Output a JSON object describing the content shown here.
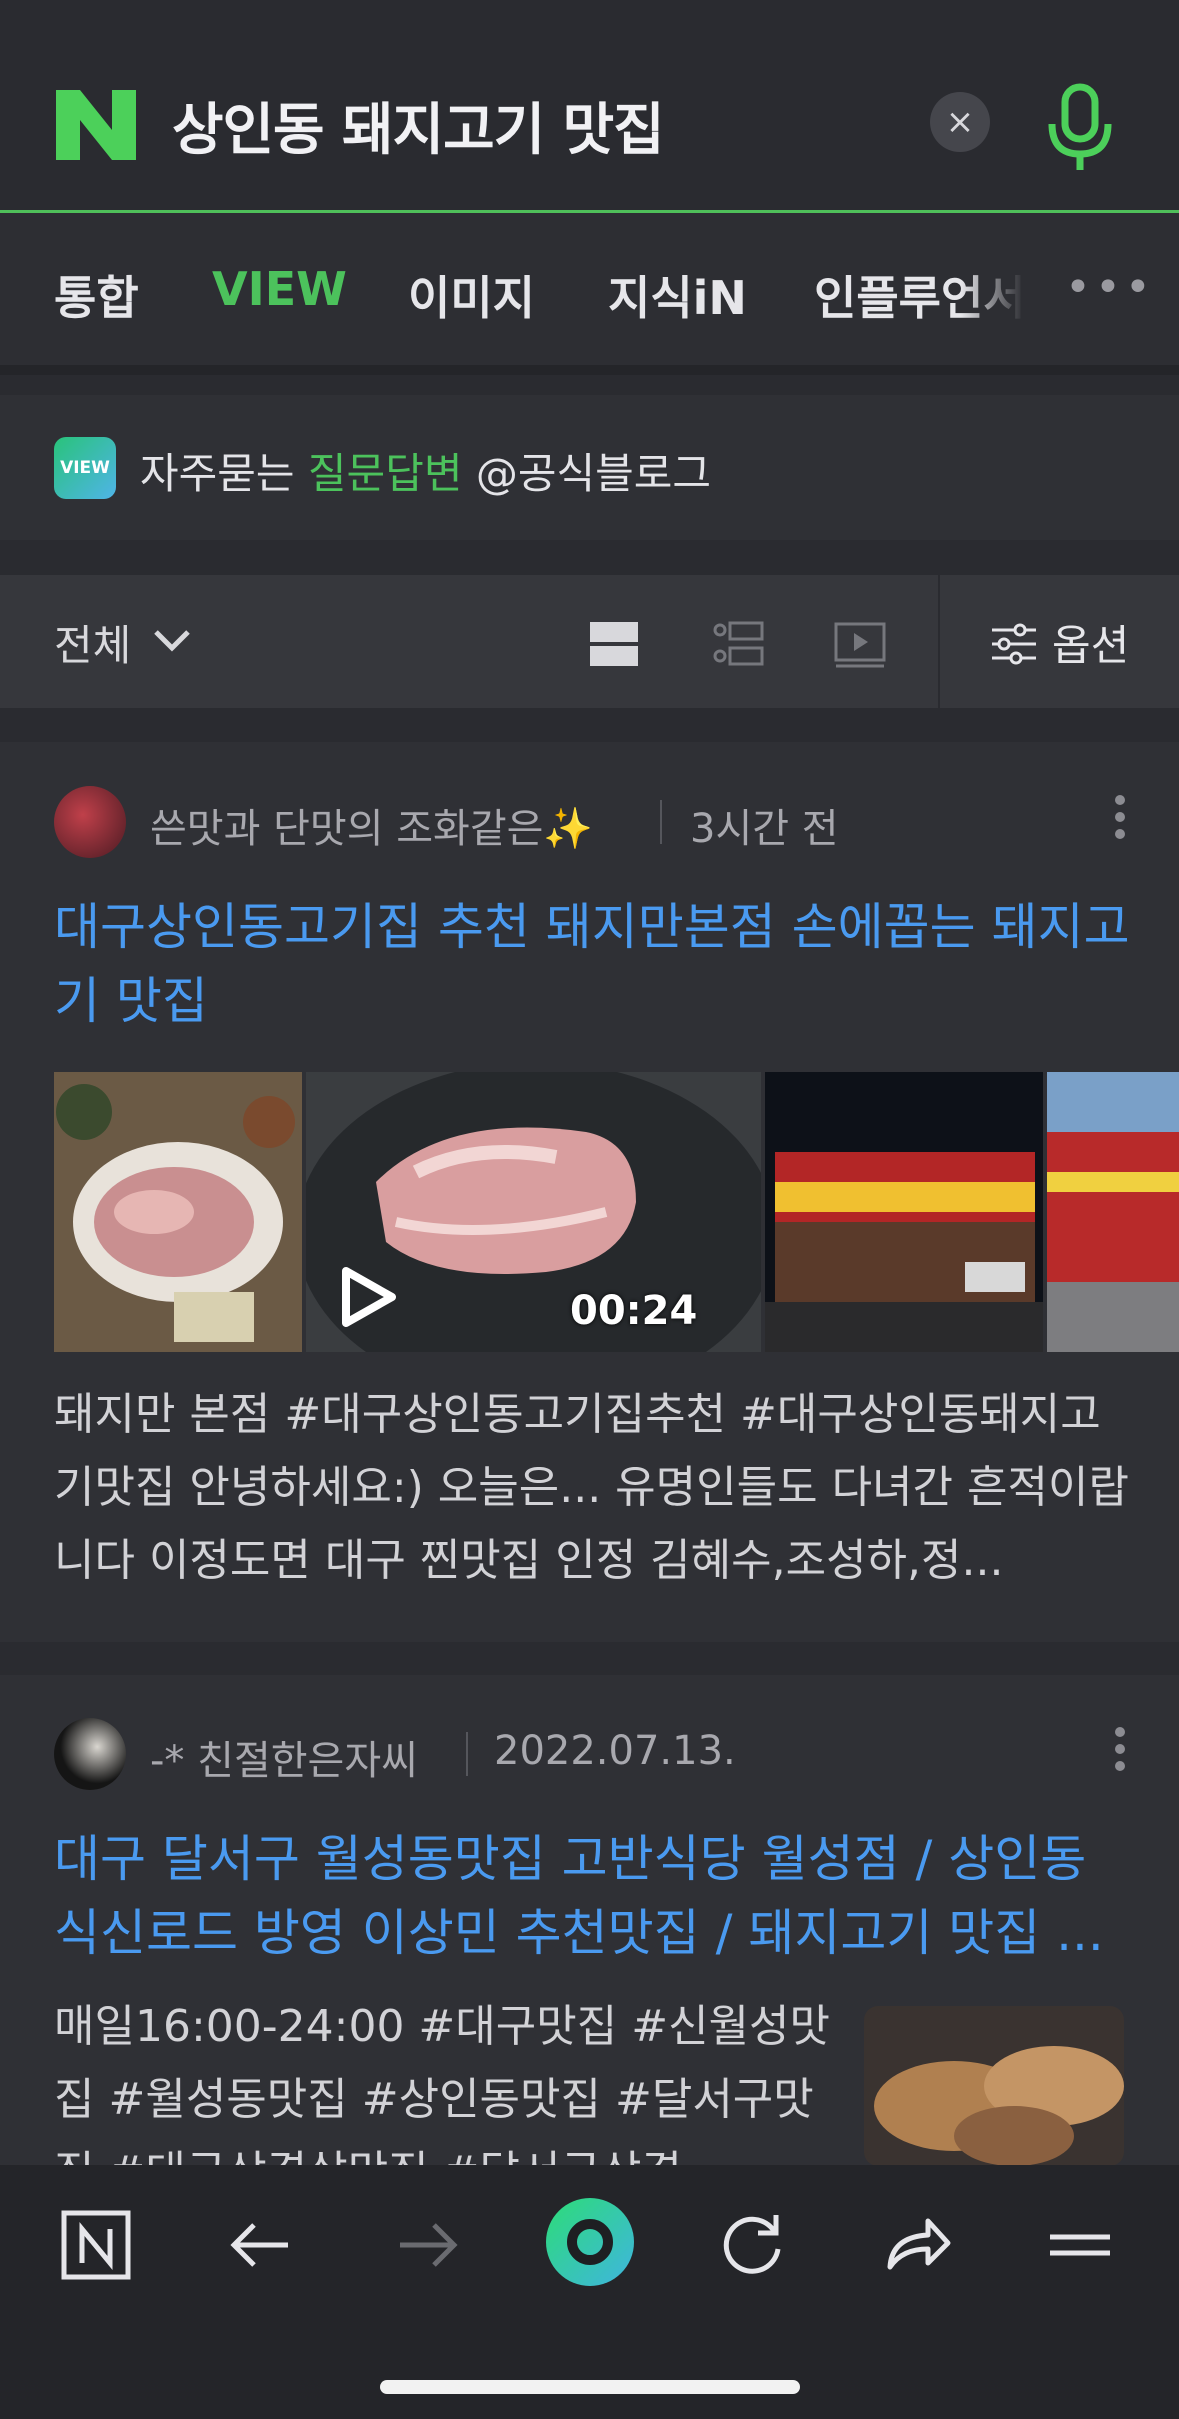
{
  "search": {
    "query": "상인동 돼지고기 맛집",
    "clear_icon": "×"
  },
  "tabs": [
    {
      "label": "통합"
    },
    {
      "label": "VIEW",
      "active": true
    },
    {
      "label": "이미지"
    },
    {
      "label": "지식iN"
    },
    {
      "label": "인플루언서"
    }
  ],
  "tabs_more": "•••",
  "faq": {
    "badge": "VIEW",
    "prefix": "자주묻는 ",
    "highlight": "질문답변",
    "suffix": " @공식블로그"
  },
  "filter": {
    "all_label": "전체",
    "options_label": "옵션"
  },
  "results": [
    {
      "author": "쓴맛과 단맛의 조화같은✨",
      "time": "3시간 전",
      "title": "대구상인동고기집 추천 돼지만본점 손에꼽는 돼지고기 맛집",
      "snippet": "돼지만 본점 #대구상인동고기집추천 #대구상인동돼지고기맛집 안녕하세요:) 오늘은... 유명인들도 다녀간 흔적이랍니다 이정도면 대구 찐맛집 인정 김혜수,조성하,정...",
      "video_duration": "00:24"
    },
    {
      "author": "-* 친절한은자씨",
      "time": "2022.07.13.",
      "title": "대구 달서구 월성동맛집 고반식당 월성점 / 상인동 식신로드 방영 이상민 추천맛집 / 돼지고기 맛집 ...",
      "snippet": "매일16:00-24:00 #대구맛집 #신월성맛집 #월성동맛집 #상인동맛집 #달서구맛집 #대구삼겹살맛집 #달서구삼겹"
    }
  ],
  "colors": {
    "accent_green": "#4cc25c",
    "link_blue": "#4a9af0",
    "background": "#2a2b30"
  }
}
